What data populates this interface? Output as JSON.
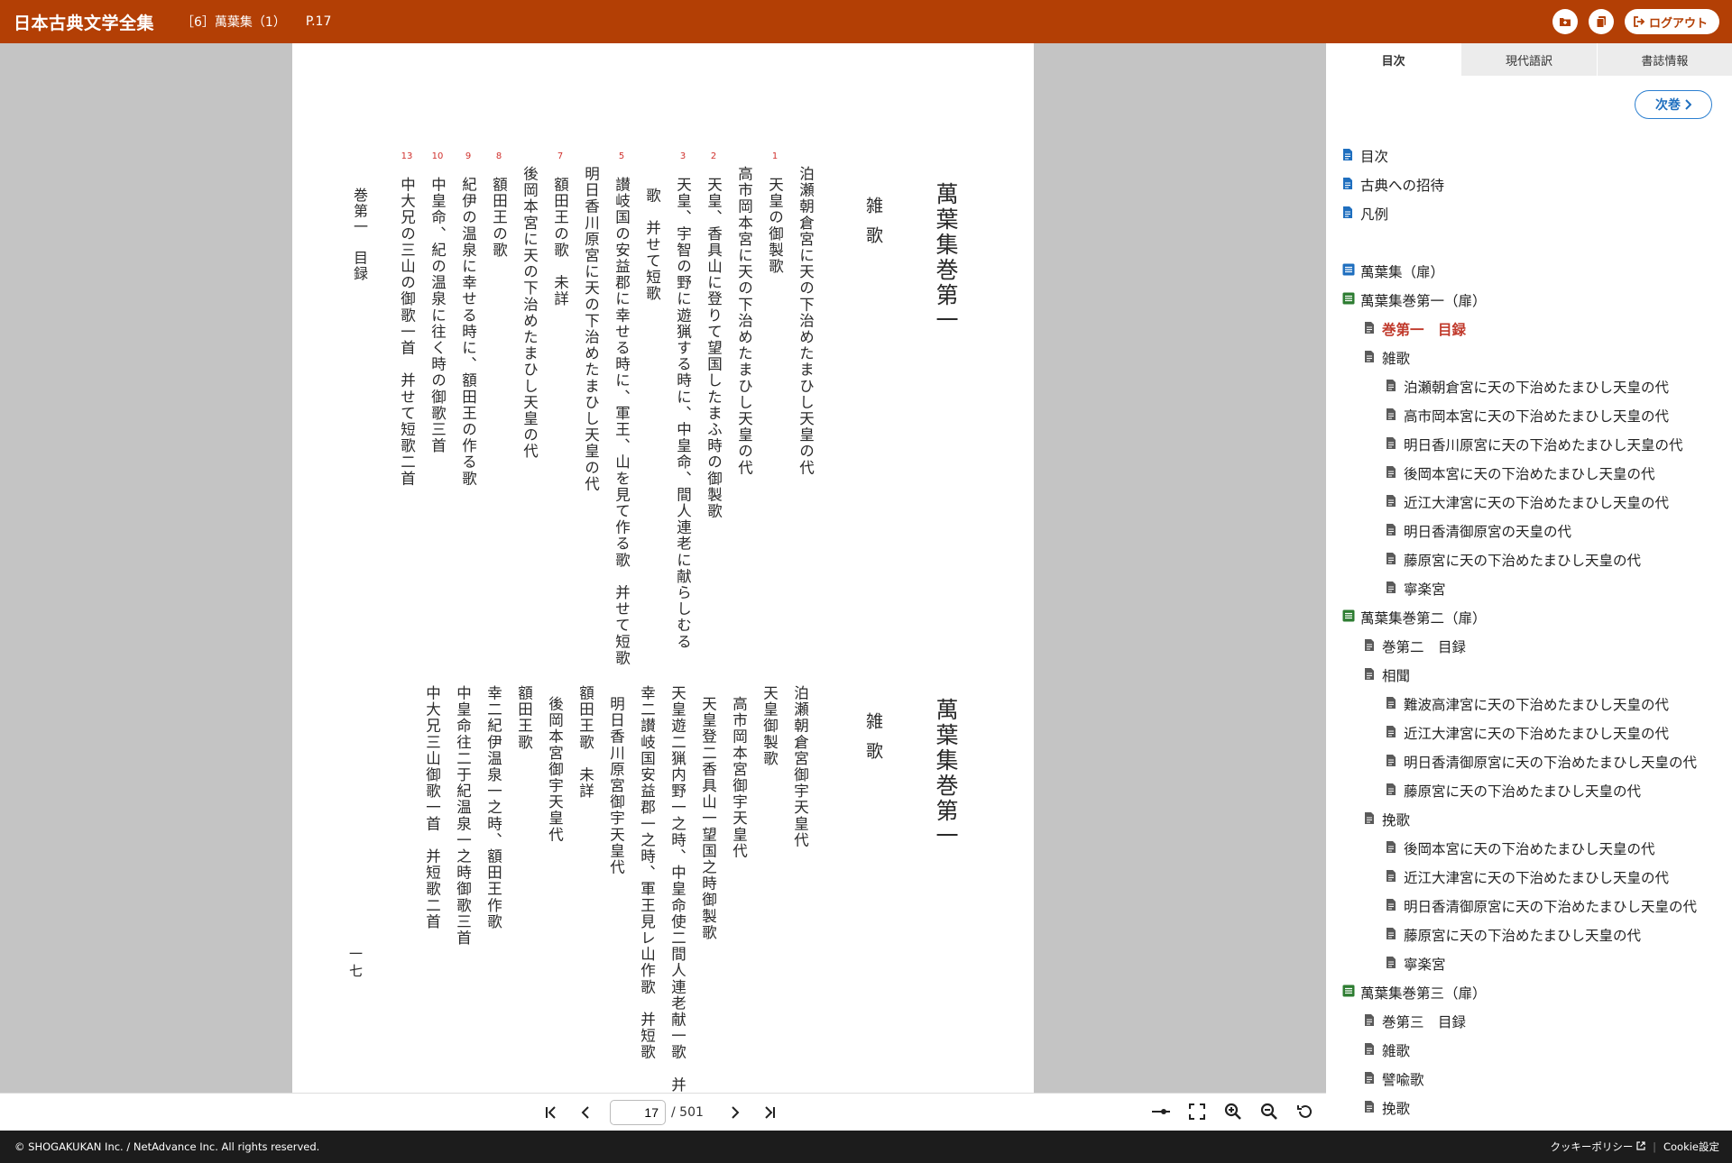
{
  "header": {
    "app_title": "日本古典文学全集",
    "volume": "［6］萬葉集（1）",
    "page": "P.17",
    "logout": "ログアウト"
  },
  "page_content": {
    "upper": {
      "book_title": "萬葉集巻第一",
      "section": "雑歌",
      "lines": [
        {
          "num": "",
          "text": "泊瀬朝倉宮に天の下治めたまひし天皇の代"
        },
        {
          "num": "1",
          "text": "天皇の御製歌"
        },
        {
          "num": "",
          "text": "高市岡本宮に天の下治めたまひし天皇の代"
        },
        {
          "num": "2",
          "text": "天皇、香具山に登りて望国したまふ時の御製歌"
        },
        {
          "num": "3",
          "text": "天皇、宇智の野に遊猟する時に、中皇命、間人連老に献らしむる"
        },
        {
          "num": "",
          "text": "歌　并せて短歌"
        },
        {
          "num": "5",
          "text": "讃岐国の安益郡に幸せる時に、軍王、山を見て作る歌　并せて短歌"
        },
        {
          "num": "",
          "text": "明日香川原宮に天の下治めたまひし天皇の代"
        },
        {
          "num": "7",
          "text": "額田王の歌　未詳"
        },
        {
          "num": "",
          "text": "後岡本宮に天の下治めたまひし天皇の代"
        },
        {
          "num": "8",
          "text": "額田王の歌"
        },
        {
          "num": "9",
          "text": "紀伊の温泉に幸せる時に、額田王の作る歌"
        },
        {
          "num": "10",
          "text": "中皇命、紀の温泉に往く時の御歌三首"
        },
        {
          "num": "13",
          "text": "中大兄の三山の御歌一首　并せて短歌二首"
        }
      ],
      "mokuroku": "巻第一　目録"
    },
    "lower": {
      "book_title": "萬葉集巻第一",
      "section": "雑歌",
      "lines": [
        "泊瀬朝倉宮御宇天皇代",
        "天皇御製歌",
        "高市岡本宮御宇天皇代",
        "天皇登二香具山一望国之時御製歌",
        "天皇遊二猟内野一之時、中皇命使二間人連老献一歌　并短歌",
        "幸二讃岐国安益郡一之時、軍王見レ山作歌　并短歌",
        "明日香川原宮御宇天皇代",
        "額田王歌　未詳",
        "後岡本宮御宇天皇代",
        "額田王歌",
        "幸二紀伊温泉一之時、額田王作歌",
        "中皇命往二于紀温泉一之時御歌三首",
        "中大兄三山御歌一首　并短歌二首"
      ],
      "page_number": "一七"
    }
  },
  "controls": {
    "current_page": "17",
    "total": "/ 501"
  },
  "sidebar": {
    "tabs": [
      "目次",
      "現代語訳",
      "書誌情報"
    ],
    "next_volume": "次巻",
    "toc": [
      {
        "label": "目次",
        "level": 1,
        "icon": "blue"
      },
      {
        "label": "古典への招待",
        "level": 1,
        "icon": "blue"
      },
      {
        "label": "凡例",
        "level": 1,
        "icon": "blue"
      },
      {
        "label": "",
        "level": 0,
        "icon": "none"
      },
      {
        "label": "萬葉集（扉）",
        "level": 1,
        "icon": "list-blue"
      },
      {
        "label": "萬葉集巻第一（扉）",
        "level": 1,
        "icon": "list-green"
      },
      {
        "label": "巻第一　目録",
        "level": 2,
        "icon": "gray",
        "current": true
      },
      {
        "label": "雑歌",
        "level": 2,
        "icon": "gray"
      },
      {
        "label": "泊瀬朝倉宮に天の下治めたまひし天皇の代",
        "level": 3,
        "icon": "gray"
      },
      {
        "label": "高市岡本宮に天の下治めたまひし天皇の代",
        "level": 3,
        "icon": "gray"
      },
      {
        "label": "明日香川原宮に天の下治めたまひし天皇の代",
        "level": 3,
        "icon": "gray"
      },
      {
        "label": "後岡本宮に天の下治めたまひし天皇の代",
        "level": 3,
        "icon": "gray"
      },
      {
        "label": "近江大津宮に天の下治めたまひし天皇の代",
        "level": 3,
        "icon": "gray"
      },
      {
        "label": "明日香清御原宮の天皇の代",
        "level": 3,
        "icon": "gray"
      },
      {
        "label": "藤原宮に天の下治めたまひし天皇の代",
        "level": 3,
        "icon": "gray"
      },
      {
        "label": "寧楽宮",
        "level": 3,
        "icon": "gray"
      },
      {
        "label": "萬葉集巻第二（扉）",
        "level": 1,
        "icon": "list-green"
      },
      {
        "label": "巻第二　目録",
        "level": 2,
        "icon": "gray"
      },
      {
        "label": "相聞",
        "level": 2,
        "icon": "gray"
      },
      {
        "label": "難波高津宮に天の下治めたまひし天皇の代",
        "level": 3,
        "icon": "gray"
      },
      {
        "label": "近江大津宮に天の下治めたまひし天皇の代",
        "level": 3,
        "icon": "gray"
      },
      {
        "label": "明日香清御原宮に天の下治めたまひし天皇の代",
        "level": 3,
        "icon": "gray"
      },
      {
        "label": "藤原宮に天の下治めたまひし天皇の代",
        "level": 3,
        "icon": "gray"
      },
      {
        "label": "挽歌",
        "level": 2,
        "icon": "gray"
      },
      {
        "label": "後岡本宮に天の下治めたまひし天皇の代",
        "level": 3,
        "icon": "gray"
      },
      {
        "label": "近江大津宮に天の下治めたまひし天皇の代",
        "level": 3,
        "icon": "gray"
      },
      {
        "label": "明日香清御原宮に天の下治めたまひし天皇の代",
        "level": 3,
        "icon": "gray"
      },
      {
        "label": "藤原宮に天の下治めたまひし天皇の代",
        "level": 3,
        "icon": "gray"
      },
      {
        "label": "寧楽宮",
        "level": 3,
        "icon": "gray"
      },
      {
        "label": "萬葉集巻第三（扉）",
        "level": 1,
        "icon": "list-green"
      },
      {
        "label": "巻第三　目録",
        "level": 2,
        "icon": "gray"
      },
      {
        "label": "雑歌",
        "level": 2,
        "icon": "gray"
      },
      {
        "label": "譬喩歌",
        "level": 2,
        "icon": "gray"
      },
      {
        "label": "挽歌",
        "level": 2,
        "icon": "gray"
      }
    ]
  },
  "footer": {
    "copyright": "© SHOGAKUKAN Inc. / NetAdvance Inc. All rights reserved.",
    "cookie_policy": "クッキーポリシー",
    "cookie_settings": "Cookie設定"
  },
  "colors": {
    "header_bg": "#b33f05",
    "accent_blue": "#1f6fbf",
    "current_red": "#c0392b",
    "footer_bg": "#1c1c1c"
  }
}
